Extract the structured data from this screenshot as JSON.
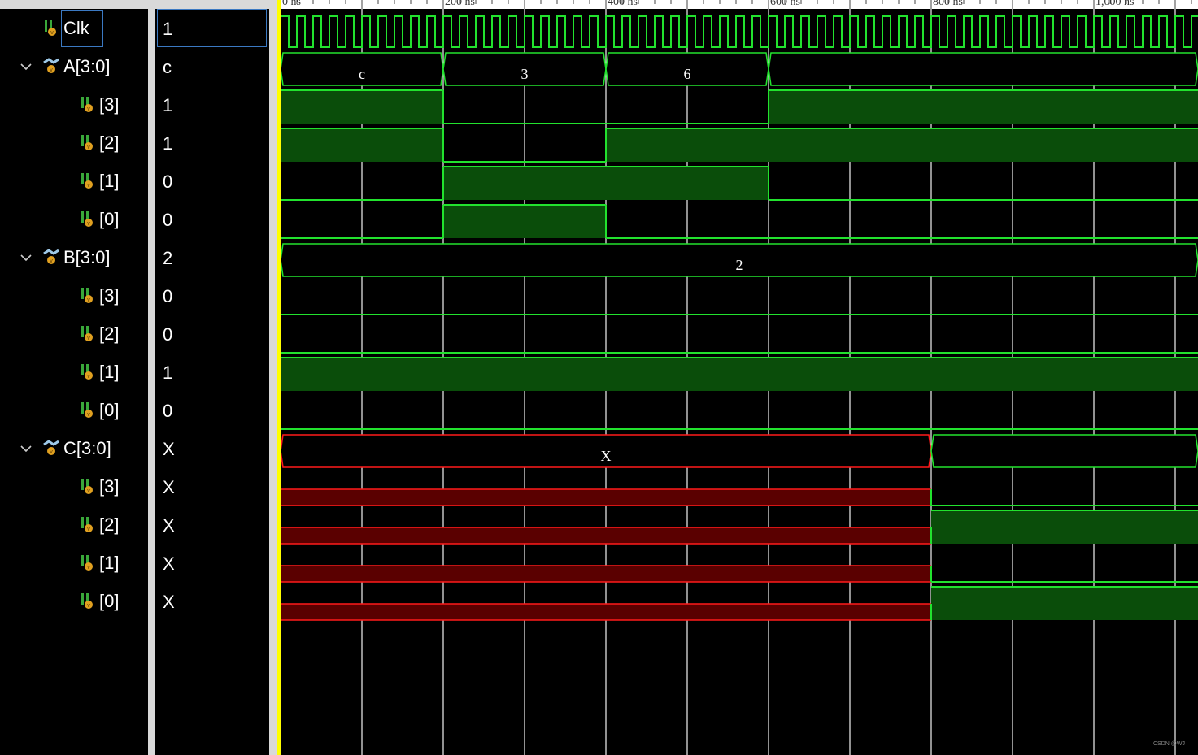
{
  "names": [
    {
      "label": "Clk",
      "indent": 0,
      "expand": false,
      "icon": "signal-bit-icon"
    },
    {
      "label": "A[3:0]",
      "indent": 0,
      "expand": true,
      "icon": "bus-icon"
    },
    {
      "label": "[3]",
      "indent": 1,
      "expand": false,
      "icon": "signal-bit-icon"
    },
    {
      "label": "[2]",
      "indent": 1,
      "expand": false,
      "icon": "signal-bit-icon"
    },
    {
      "label": "[1]",
      "indent": 1,
      "expand": false,
      "icon": "signal-bit-icon"
    },
    {
      "label": "[0]",
      "indent": 1,
      "expand": false,
      "icon": "signal-bit-icon"
    },
    {
      "label": "B[3:0]",
      "indent": 0,
      "expand": true,
      "icon": "bus-icon"
    },
    {
      "label": "[3]",
      "indent": 1,
      "expand": false,
      "icon": "signal-bit-icon"
    },
    {
      "label": "[2]",
      "indent": 1,
      "expand": false,
      "icon": "signal-bit-icon"
    },
    {
      "label": "[1]",
      "indent": 1,
      "expand": false,
      "icon": "signal-bit-icon"
    },
    {
      "label": "[0]",
      "indent": 1,
      "expand": false,
      "icon": "signal-bit-icon"
    },
    {
      "label": "C[3:0]",
      "indent": 0,
      "expand": true,
      "icon": "bus-icon"
    },
    {
      "label": "[3]",
      "indent": 1,
      "expand": false,
      "icon": "signal-bit-icon"
    },
    {
      "label": "[2]",
      "indent": 1,
      "expand": false,
      "icon": "signal-bit-icon"
    },
    {
      "label": "[1]",
      "indent": 1,
      "expand": false,
      "icon": "signal-bit-icon"
    },
    {
      "label": "[0]",
      "indent": 1,
      "expand": false,
      "icon": "signal-bit-icon"
    }
  ],
  "values": [
    "1",
    "c",
    "1",
    "1",
    "0",
    "0",
    "2",
    "0",
    "0",
    "1",
    "0",
    "X",
    "X",
    "X",
    "X",
    "X"
  ],
  "timeline": {
    "labels": [
      "0 ns",
      "200 ns",
      "400 ns",
      "600 ns",
      "800 ns",
      "1,000 ns"
    ],
    "visible_start_ns": 0,
    "visible_end_ns": 1130,
    "clock_period_ns": 20
  },
  "waves": {
    "A": {
      "segments": [
        {
          "from": 0,
          "to": 200,
          "label": "c"
        },
        {
          "from": 200,
          "to": 400,
          "label": "3"
        },
        {
          "from": 400,
          "to": 600,
          "label": "6"
        },
        {
          "from": 600,
          "to": 1130,
          "label": ""
        }
      ]
    },
    "A_bits": [
      [
        [
          0,
          200,
          1
        ],
        [
          200,
          600,
          0
        ],
        [
          600,
          1130,
          1
        ]
      ],
      [
        [
          0,
          200,
          1
        ],
        [
          200,
          400,
          0
        ],
        [
          400,
          1130,
          1
        ]
      ],
      [
        [
          0,
          200,
          0
        ],
        [
          200,
          600,
          1
        ],
        [
          600,
          1130,
          0
        ]
      ],
      [
        [
          0,
          200,
          0
        ],
        [
          200,
          400,
          1
        ],
        [
          400,
          1130,
          0
        ]
      ]
    ],
    "B": {
      "segments": [
        {
          "from": 0,
          "to": 1130,
          "label": "2"
        }
      ]
    },
    "B_bits": [
      [
        [
          0,
          1130,
          0
        ]
      ],
      [
        [
          0,
          1130,
          0
        ]
      ],
      [
        [
          0,
          1130,
          1
        ]
      ],
      [
        [
          0,
          1130,
          0
        ]
      ]
    ],
    "C": {
      "segments": [
        {
          "from": 0,
          "to": 800,
          "label": "X",
          "unknown": true
        },
        {
          "from": 800,
          "to": 1130,
          "label": ""
        }
      ]
    },
    "C_bits": [
      [
        [
          0,
          800,
          "X"
        ],
        [
          800,
          1130,
          0
        ]
      ],
      [
        [
          0,
          800,
          "X"
        ],
        [
          800,
          1130,
          1
        ]
      ],
      [
        [
          0,
          800,
          "X"
        ],
        [
          800,
          1130,
          0
        ]
      ],
      [
        [
          0,
          800,
          "X"
        ],
        [
          800,
          1130,
          1
        ]
      ]
    ]
  },
  "colors": {
    "wave": "#22e22e",
    "fill": "#0a4d0a",
    "unknown": "#ff1a1a",
    "unknown_fill": "#5a0000",
    "grid": "#e0e0e0",
    "cursor": "#ffff00",
    "selection": "#3b79c2"
  },
  "watermark": "CSDN @WJ"
}
